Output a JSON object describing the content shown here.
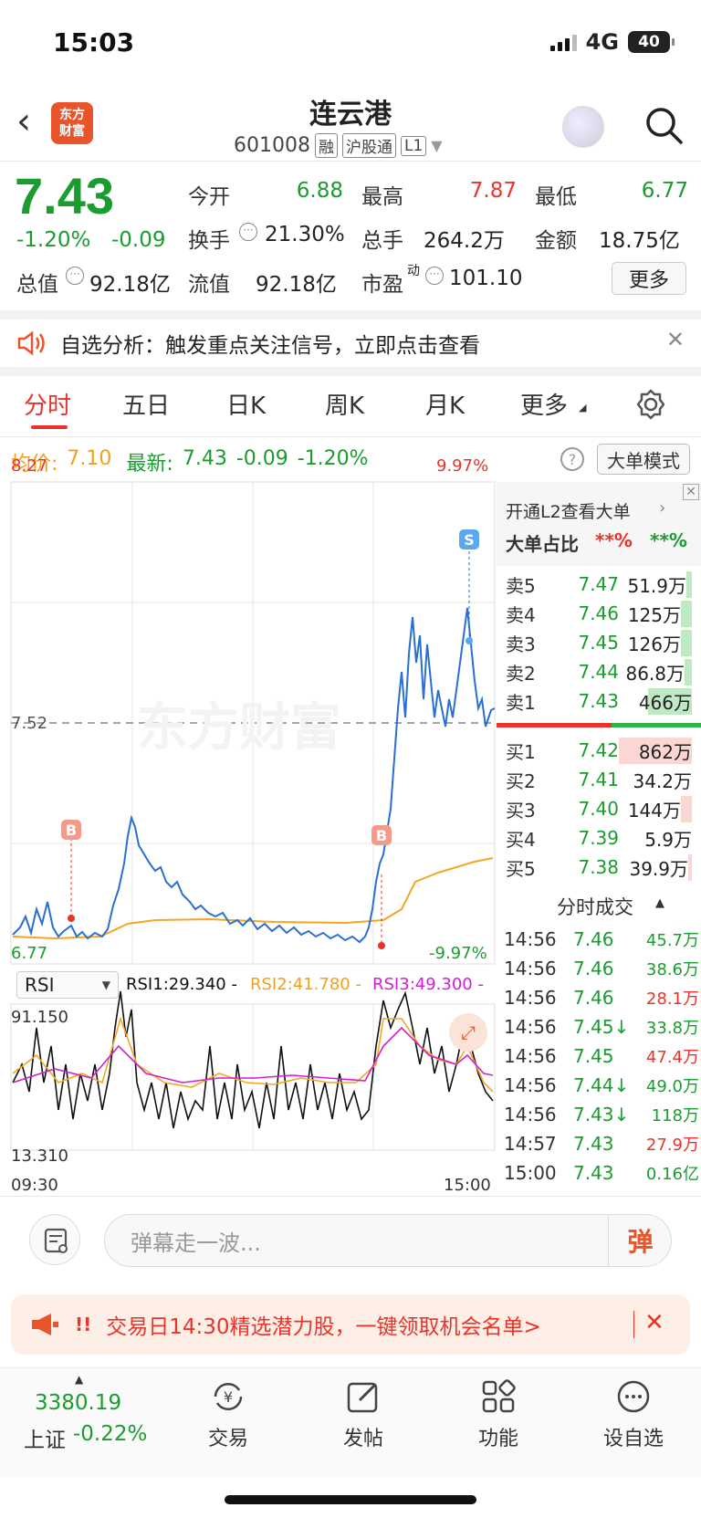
{
  "status": {
    "time": "15:03",
    "network": "4G",
    "battery": "40"
  },
  "header": {
    "logo_line1": "东方",
    "logo_line2": "财富",
    "title": "连云港",
    "code": "601008",
    "tags": [
      "融",
      "沪股通",
      "L1"
    ]
  },
  "quote": {
    "price": "7.43",
    "change_pct": "-1.20%",
    "change": "-0.09",
    "open_label": "今开",
    "open": "6.88",
    "high_label": "最高",
    "high": "7.87",
    "low_label": "最低",
    "low": "6.77",
    "turnover_label": "换手",
    "turnover": "21.30%",
    "volume_label": "总手",
    "volume": "264.2万",
    "amount_label": "金额",
    "amount": "18.75亿",
    "mktcap_label": "总值",
    "mktcap": "92.18亿",
    "float_label": "流值",
    "float": "92.18亿",
    "pe_label": "市盈",
    "pe_sup": "动",
    "pe": "101.10",
    "more": "更多"
  },
  "alert": {
    "text": "自选分析：触发重点关注信号，立即点击查看"
  },
  "tabs": [
    "分时",
    "五日",
    "日K",
    "周K",
    "月K",
    "更多"
  ],
  "info": {
    "avg_label": "均价:",
    "avg": "7.10",
    "latest_label": "最新:",
    "latest": "7.43",
    "chg": "-0.09",
    "pct": "-1.20%",
    "help": "?",
    "bigmode": "大单模式"
  },
  "chart_labels": {
    "top_price": "8.27",
    "top_pct": "9.97%",
    "mid_price": "7.52",
    "bot_price": "6.77",
    "bot_pct": "-9.97%",
    "watermark": "东方财富",
    "b_marker": "B",
    "s_marker": "S",
    "time_start": "09:30",
    "time_end": "15:00"
  },
  "rsi": {
    "select": "RSI",
    "rsi1": "RSI1:29.340 -",
    "rsi2": "RSI2:41.780 -",
    "rsi3": "RSI3:49.300 -",
    "max": "91.150",
    "min": "13.310"
  },
  "l2": {
    "open_text": "开通L2查看大单",
    "ratio_label": "大单占比",
    "sell_ratio": "**%",
    "buy_ratio": "**%"
  },
  "order_book": {
    "sells": [
      {
        "label": "卖5",
        "price": "7.47",
        "vol": "51.9万"
      },
      {
        "label": "卖4",
        "price": "7.46",
        "vol": "125万"
      },
      {
        "label": "卖3",
        "price": "7.45",
        "vol": "126万"
      },
      {
        "label": "卖2",
        "price": "7.44",
        "vol": "86.8万"
      },
      {
        "label": "卖1",
        "price": "7.43",
        "vol": "466万"
      }
    ],
    "buys": [
      {
        "label": "买1",
        "price": "7.42",
        "vol": "862万"
      },
      {
        "label": "买2",
        "price": "7.41",
        "vol": "34.2万"
      },
      {
        "label": "买3",
        "price": "7.40",
        "vol": "144万"
      },
      {
        "label": "买4",
        "price": "7.39",
        "vol": "5.9万"
      },
      {
        "label": "买5",
        "price": "7.38",
        "vol": "39.9万"
      }
    ]
  },
  "ticks_title": "分时成交",
  "ticks": [
    {
      "time": "14:56",
      "price": "7.46",
      "vol": "45.7万",
      "color": "green"
    },
    {
      "time": "14:56",
      "price": "7.46",
      "vol": "38.6万",
      "color": "green"
    },
    {
      "time": "14:56",
      "price": "7.46",
      "vol": "28.1万",
      "color": "red"
    },
    {
      "time": "14:56",
      "price": "7.45↓",
      "vol": "33.8万",
      "color": "green"
    },
    {
      "time": "14:56",
      "price": "7.45",
      "vol": "47.4万",
      "color": "red"
    },
    {
      "time": "14:56",
      "price": "7.44↓",
      "vol": "49.0万",
      "color": "green"
    },
    {
      "time": "14:56",
      "price": "7.43↓",
      "vol": "118万",
      "color": "green"
    },
    {
      "time": "14:57",
      "price": "7.43",
      "vol": "27.9万",
      "color": "red"
    },
    {
      "time": "15:00",
      "price": "7.43",
      "vol": "0.16亿",
      "color": "green"
    }
  ],
  "comment": {
    "placeholder": "弹幕走一波...",
    "btn": "弹"
  },
  "promo": {
    "text": "交易日14:30精选潜力股，一键领取机会名单>"
  },
  "bottom_nav": {
    "index_value": "3380.19",
    "index_name": "上证",
    "index_pct": "-0.22%",
    "items": [
      "交易",
      "发帖",
      "功能",
      "设自选"
    ]
  }
}
